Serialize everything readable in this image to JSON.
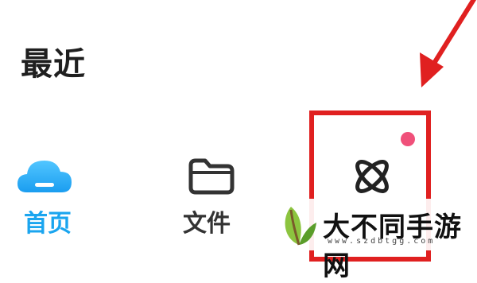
{
  "header": {
    "title": "最近"
  },
  "tabs": [
    {
      "label": "首页",
      "icon": "cloud-icon",
      "active": true,
      "color": "#1aa5ef"
    },
    {
      "label": "文件",
      "icon": "folder-icon",
      "active": false,
      "color": "#333333"
    },
    {
      "label": "",
      "icon": "atom-icon",
      "active": false,
      "badge": "notification-dot"
    }
  ],
  "annotation": {
    "box_color": "#e02020",
    "arrow_color": "#e02020"
  },
  "watermark": {
    "text": "大不同手游网",
    "url": "www.szdbtgg.com"
  }
}
